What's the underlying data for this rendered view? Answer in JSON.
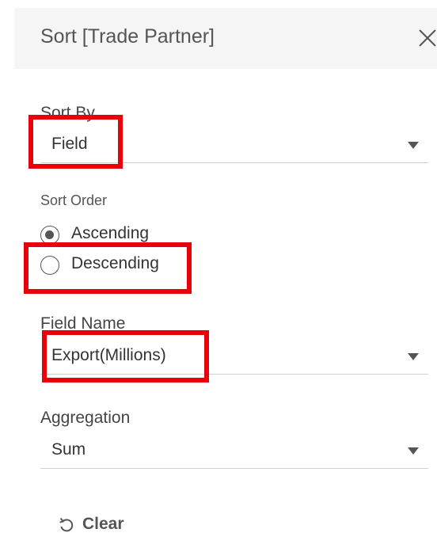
{
  "dialog": {
    "title": "Sort [Trade Partner]",
    "close_icon": "close-icon"
  },
  "sort_by": {
    "label": "Sort By",
    "value": "Field"
  },
  "sort_order": {
    "label": "Sort Order",
    "options": [
      {
        "label": "Ascending",
        "selected": true
      },
      {
        "label": "Descending",
        "selected": false
      }
    ]
  },
  "field_name": {
    "label": "Field Name",
    "value": "Export(Millions)"
  },
  "aggregation": {
    "label": "Aggregation",
    "value": "Sum"
  },
  "footer": {
    "clear_label": "Clear",
    "clear_icon": "undo-icon"
  },
  "colors": {
    "highlight": "#e8000a",
    "header_bg": "#f5f5f5",
    "text": "#333333"
  }
}
